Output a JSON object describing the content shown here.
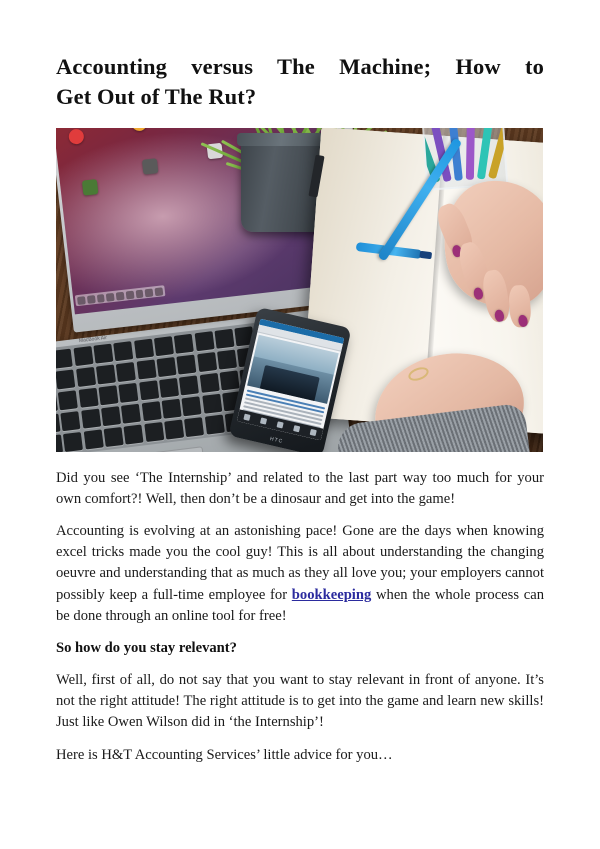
{
  "document": {
    "title_line_1": "Accounting versus The Machine; How to",
    "title_line_2": "Get Out of The Rut?",
    "title_full": "Accounting versus The Machine; How to Get Out of The Rut?"
  },
  "figure": {
    "alt": "Desk scene with MacBook Air laptop, potted plant, smartphone showing a web page, and a hand writing in an open notebook with a blue pen",
    "scene_objects": [
      "macbook-air-laptop",
      "potted-grass-plant",
      "smartphone",
      "open-notebook",
      "blue-pen",
      "blue-marker",
      "glass-pen-holder",
      "wooden-desk",
      "hand-with-purple-nails",
      "grey-knit-sleeve"
    ],
    "colors": {
      "desk_wood": "#5d3a20",
      "laptop_body": "#b4b8bb",
      "laptop_wallpaper": "#6a3159",
      "plant_pot": "#444b51",
      "plant_leaves": "#6fa83a",
      "notebook_page": "#f8f5ee",
      "phone_body": "#23282d",
      "pen_blue": "#2ea0e6",
      "nail_polish": "#9c2f78",
      "sleeve_grey": "#8a9096"
    },
    "desktop_icons": [
      {
        "color": "#e03c3c",
        "shape": "circle"
      },
      {
        "color": "#f0a830",
        "shape": "circle"
      },
      {
        "color": "#3d7fd1",
        "shape": "circle"
      },
      {
        "color": "#4a7a35",
        "shape": "square"
      },
      {
        "color": "#5a5a5a",
        "shape": "square"
      },
      {
        "color": "#d8d8d8",
        "shape": "square"
      }
    ],
    "pen_cup_colors": [
      "#2aa79b",
      "#7b4fc0",
      "#3d7fd1",
      "#9c57c8",
      "#2ec4b6",
      "#c9a227"
    ],
    "mac_label": "MacBook Air"
  },
  "content": {
    "paragraph_1": "Did you see ‘The Internship’ and related to the last part way too much for your own comfort?! Well, then don’t be a dinosaur and get into the game!",
    "paragraph_2_part_1": "Accounting is evolving at an astonishing pace! Gone are the days when knowing excel tricks made you the cool guy! This is all about understanding the changing oeuvre and understanding that as much as they all love you; your employers cannot possibly keep a full-time employee for ",
    "paragraph_2_link": "bookkeeping",
    "paragraph_2_part_2": " when the whole process can be done through an online tool for free!",
    "subheading": "So how do you stay relevant?",
    "paragraph_3": "Well, first of all, do not say that you want to stay relevant in front of anyone. It’s not the right attitude! The right attitude is to get into the game and learn new skills! Just like Owen Wilson did in ‘the Internship’!",
    "paragraph_4": "Here is H&T Accounting Services’ little advice for you…"
  },
  "link_color": "#2b2b9e"
}
